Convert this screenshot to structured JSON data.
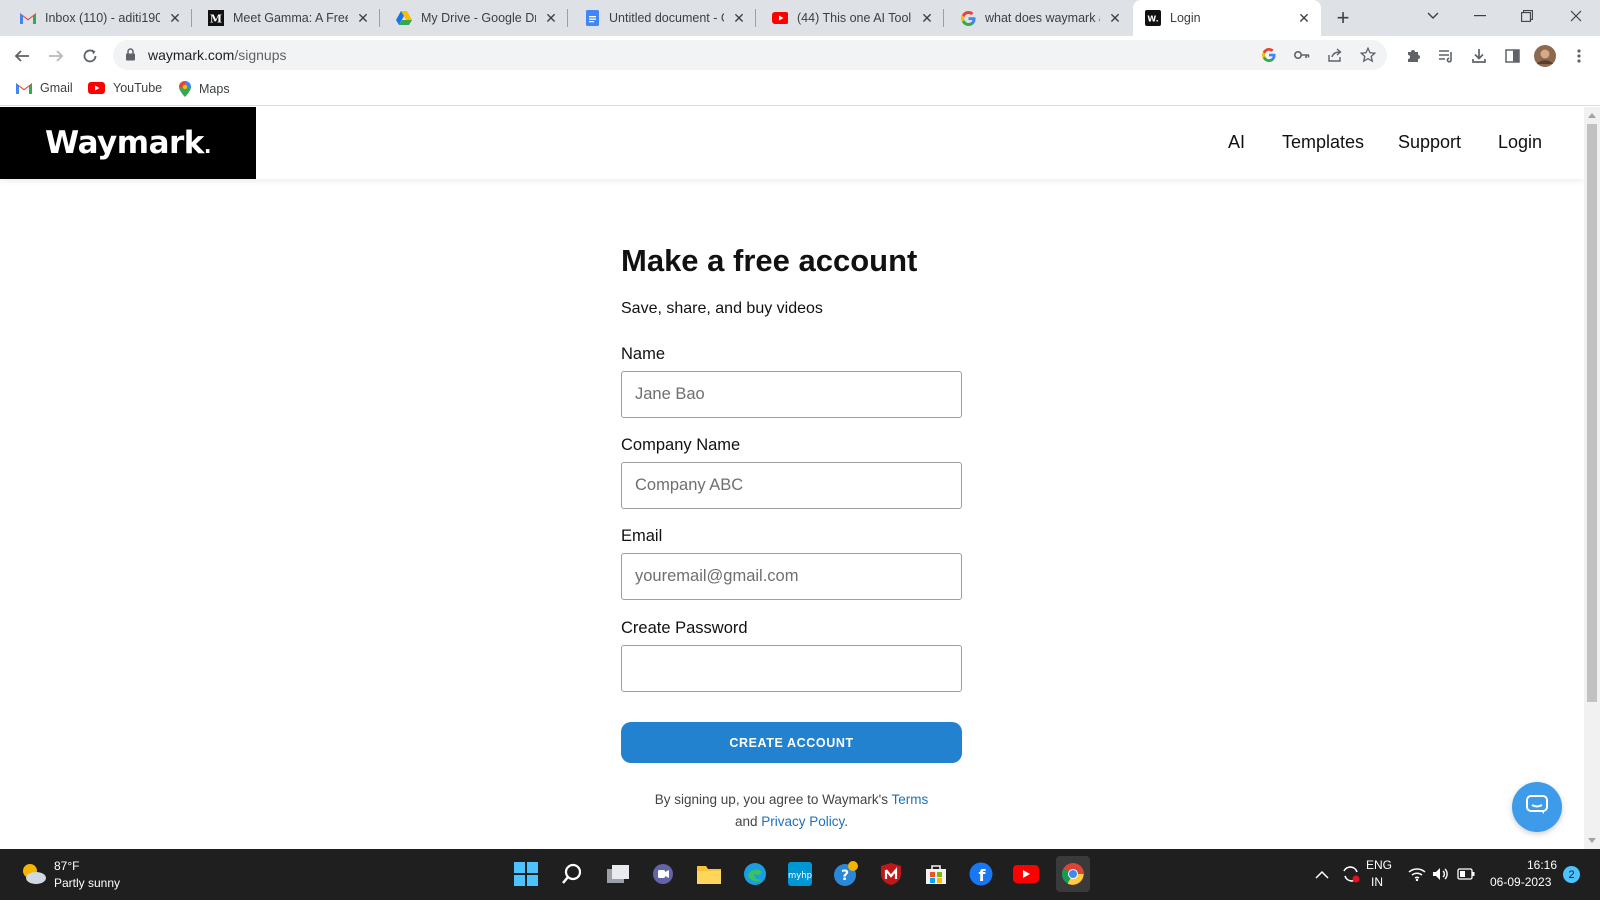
{
  "browser": {
    "tabs": [
      {
        "title": "Inbox (110) - aditi190",
        "icon": "gmail-icon"
      },
      {
        "title": "Meet Gamma: A Free",
        "icon": "medium-icon"
      },
      {
        "title": "My Drive - Google Dr",
        "icon": "google-drive-icon"
      },
      {
        "title": "Untitled document - G",
        "icon": "google-docs-icon"
      },
      {
        "title": "(44) This one AI Tool i",
        "icon": "youtube-icon"
      },
      {
        "title": "what does waymark a",
        "icon": "google-icon"
      },
      {
        "title": "Login",
        "icon": "waymark-icon",
        "active": true
      }
    ],
    "url_host": "waymark.com",
    "url_path": "/signups",
    "bookmarks": [
      {
        "label": "Gmail",
        "icon": "gmail-icon"
      },
      {
        "label": "YouTube",
        "icon": "youtube-icon"
      },
      {
        "label": "Maps",
        "icon": "maps-icon"
      }
    ]
  },
  "site": {
    "logo": "Waymark",
    "logo_dot": ".",
    "nav": [
      "AI",
      "Templates",
      "Support",
      "Login"
    ]
  },
  "form": {
    "title": "Make a free account",
    "subtitle": "Save, share, and buy videos",
    "fields": [
      {
        "label": "Name",
        "placeholder": "Jane Bao",
        "value": ""
      },
      {
        "label": "Company Name",
        "placeholder": "Company ABC",
        "value": ""
      },
      {
        "label": "Email",
        "placeholder": "youremail@gmail.com",
        "value": ""
      },
      {
        "label": "Create Password",
        "placeholder": "",
        "value": ""
      }
    ],
    "submit_label": "CREATE ACCOUNT",
    "terms_prefix": "By signing up, you agree to Waymark's ",
    "terms_link": "Terms",
    "terms_and": "and ",
    "privacy_link": "Privacy Policy",
    "terms_suffix": "."
  },
  "taskbar": {
    "weather_temp": "87°F",
    "weather_desc": "Partly sunny",
    "lang_top": "ENG",
    "lang_bottom": "IN",
    "time": "16:16",
    "date": "06-09-2023",
    "notification_count": "2"
  },
  "colors": {
    "accent": "#2282cf",
    "link": "#1e6fb8",
    "logo_bg": "#000000"
  }
}
